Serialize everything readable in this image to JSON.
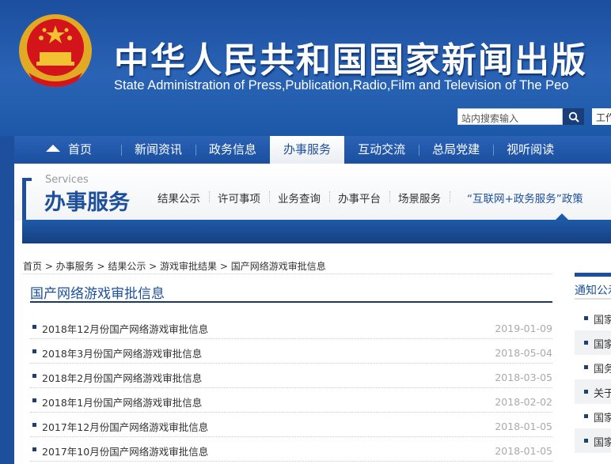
{
  "header": {
    "title": "中华人民共和国国家新闻出版",
    "subtitle": "State Administration of Press,Publication,Radio,Film and Television of The Peo",
    "search_placeholder": "站内搜索输入",
    "work_link": "工作"
  },
  "nav": [
    "首页",
    "新闻资讯",
    "政务信息",
    "办事服务",
    "互动交流",
    "总局党建",
    "视听阅读"
  ],
  "services": {
    "en": "Services",
    "cn": "办事服务",
    "subnav": [
      "结果公示",
      "许可事项",
      "业务查询",
      "办事平台",
      "场景服务",
      "“互联网+政务服务”政策"
    ]
  },
  "breadcrumb": "首页 > 办事服务 > 结果公示 > 游戏审批结果 > 国产网络游戏审批信息",
  "list_title": "国产网络游戏审批信息",
  "list": [
    {
      "title": "2018年12月份国产网络游戏审批信息",
      "date": "2019-01-09"
    },
    {
      "title": "2018年3月份国产网络游戏审批信息",
      "date": "2018-05-04"
    },
    {
      "title": "2018年2月份国产网络游戏审批信息",
      "date": "2018-03-05"
    },
    {
      "title": "2018年1月份国产网络游戏审批信息",
      "date": "2018-02-02"
    },
    {
      "title": "2017年12月份国产网络游戏审批信息",
      "date": "2018-01-05"
    },
    {
      "title": "2017年10月份国产网络游戏审批信息",
      "date": "2018-01-05"
    }
  ],
  "sidebar": {
    "title": "通知公示",
    "items": [
      "国家",
      "国家",
      "国务",
      "关于",
      "国家",
      "国家"
    ]
  },
  "colors": {
    "brand": "#1d4f9c",
    "emblem_red": "#d4141b",
    "gold": "#f3c232"
  }
}
